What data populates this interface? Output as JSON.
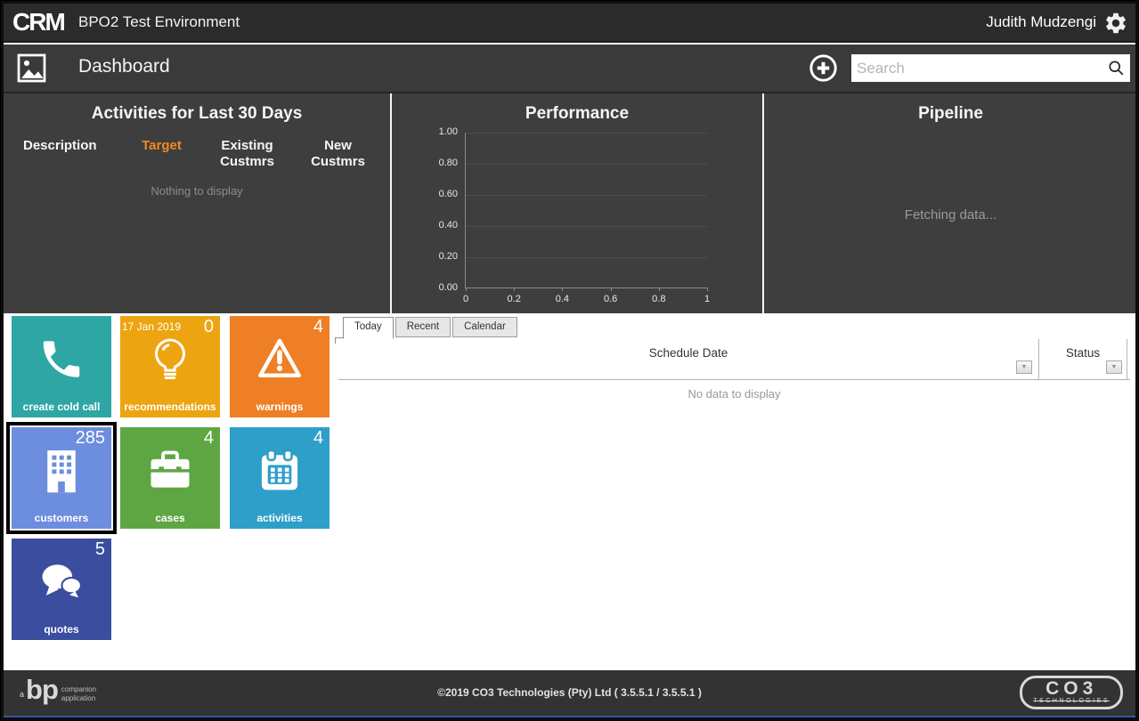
{
  "colors": {
    "top_bar_bg": "#2b2b2b",
    "header_bar_bg": "#3a3a3a",
    "panel_bg": "#3e3e3e",
    "footer_bg": "#333333",
    "accent_blue": "#2b5aa7",
    "target_orange": "#ef8b1f"
  },
  "icons": {
    "dropdown_arrow": "▼"
  },
  "top_bar": {
    "logo_text": "CRM",
    "environment_title": "BPO2 Test Environment",
    "user_name": "Judith Mudzengi"
  },
  "header_bar": {
    "page_title": "Dashboard",
    "search_placeholder": "Search"
  },
  "activities_panel": {
    "title": "Activities for Last 30 Days",
    "columns": [
      {
        "label": "Description"
      },
      {
        "label": "Target",
        "highlighted": true
      },
      {
        "label": "Existing Custmrs"
      },
      {
        "label": "New Custmrs"
      }
    ],
    "empty_text": "Nothing to display"
  },
  "pipeline_panel": {
    "title": "Pipeline",
    "loading_text": "Fetching data..."
  },
  "chart_data": {
    "type": "line",
    "title": "Performance",
    "series": [],
    "x_tick_labels": [
      "0",
      "0.2",
      "0.4",
      "0.6",
      "0.8",
      "1"
    ],
    "y_tick_labels": [
      "1.00",
      "0.80",
      "0.60",
      "0.40",
      "0.20",
      "0.00"
    ],
    "xlim": [
      0,
      1
    ],
    "ylim": [
      0,
      1
    ],
    "grid": true,
    "legend": false,
    "note": "Empty axes - no data plotted yet"
  },
  "tiles": [
    {
      "label": "create cold call",
      "color": "#2ea7a4"
    },
    {
      "label": "recommendations",
      "color": "#eca411",
      "date": "17 Jan 2019",
      "count": "0"
    },
    {
      "label": "warnings",
      "color": "#ee7f25",
      "count": "4"
    },
    {
      "label": "customers",
      "color": "#6d8dde",
      "count": "285",
      "selected": true
    },
    {
      "label": "cases",
      "color": "#5ea643",
      "count": "4"
    },
    {
      "label": "activities",
      "color": "#2d9fc9",
      "count": "4"
    },
    {
      "label": "quotes",
      "color": "#3a4d9f",
      "count": "5"
    }
  ],
  "schedule_grid": {
    "tabs": [
      {
        "label": "Today",
        "active": true
      },
      {
        "label": "Recent",
        "active": false
      },
      {
        "label": "Calendar",
        "active": false
      }
    ],
    "columns": [
      "Schedule Date",
      "Status"
    ],
    "empty_text": "No data to display"
  },
  "footer": {
    "copyright": "©2019 CO3 Technologies (Pty) Ltd ( 3.5.5.1 / 3.5.5.1 )",
    "bp_logo_prefix": "a",
    "bp_logo_letters": "bp",
    "bp_logo_line1": "companion",
    "bp_logo_line2": "application",
    "co3_logo_name": "CO3",
    "co3_logo_sub": "TECHNOLOGIES"
  }
}
